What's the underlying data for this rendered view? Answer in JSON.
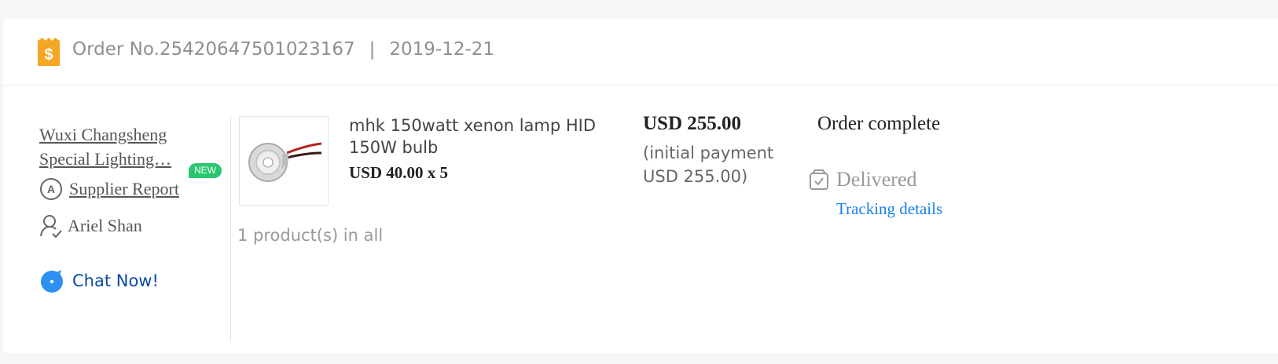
{
  "order": {
    "number_label": "Order No.25420647501023167",
    "separator": "|",
    "date": "2019-12-21"
  },
  "supplier": {
    "name": "Wuxi Changsheng Special Lighting…",
    "report_label": "Supplier Report",
    "new_badge": "NEW",
    "contact_name": "Ariel Shan",
    "chat_label": "Chat Now!"
  },
  "product": {
    "title": "mhk 150watt xenon lamp HID 150W bulb",
    "unit_price_qty": "USD 40.00 x 5",
    "count_summary": "1 product(s) in all"
  },
  "payment": {
    "total": "USD 255.00",
    "initial_payment": "(initial payment USD 255.00)"
  },
  "status": {
    "title": "Order complete",
    "delivery": "Delivered",
    "tracking_label": "Tracking details"
  },
  "colors": {
    "accent_orange": "#f5a623",
    "link_blue": "#1a7ff0",
    "chat_blue": "#0a4aa2",
    "badge_green": "#28c76f"
  },
  "icons": [
    "order-shield-icon",
    "supplier-a-icon",
    "person-check-icon",
    "chat-bubble-icon",
    "box-check-icon"
  ]
}
